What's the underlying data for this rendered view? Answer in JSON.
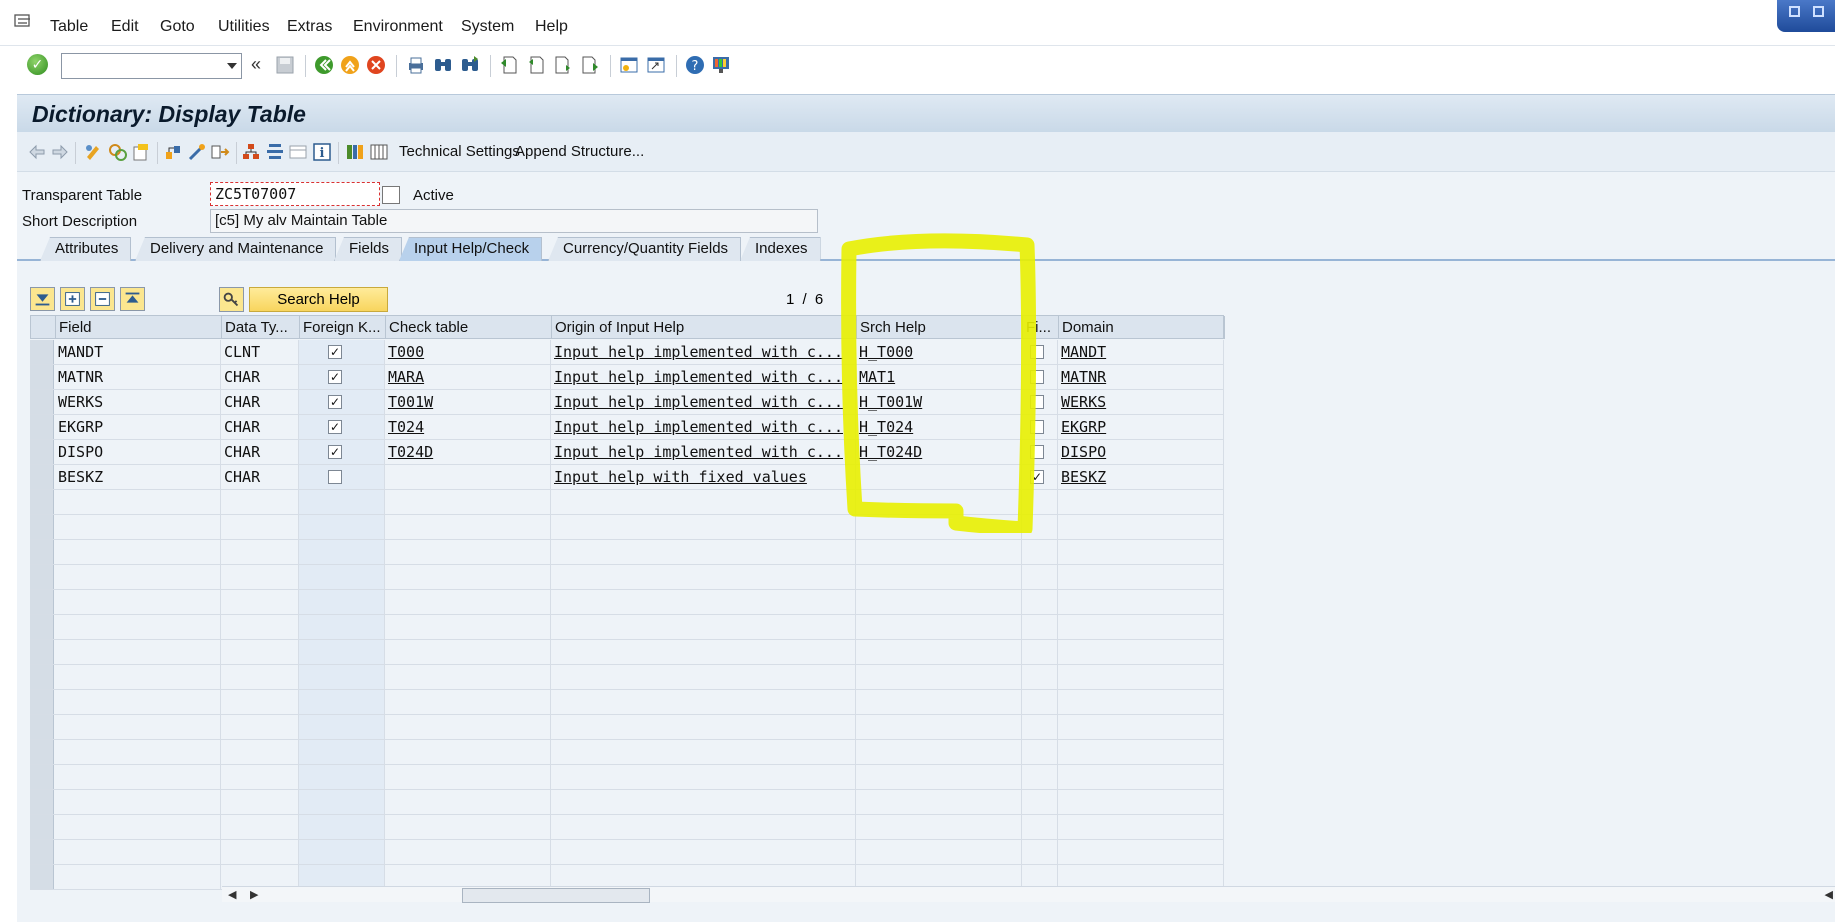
{
  "menu": {
    "items": [
      {
        "label": "Table"
      },
      {
        "label": "Edit"
      },
      {
        "label": "Goto"
      },
      {
        "label": "Utilities"
      },
      {
        "label": "Extras"
      },
      {
        "label": "Environment"
      },
      {
        "label": "System"
      },
      {
        "label": "Help"
      }
    ]
  },
  "systoolbar": {
    "command_value": "",
    "icons": [
      "enter-icon",
      "save-icon",
      "back-icon",
      "exit-icon",
      "cancel-icon",
      "print-icon",
      "find-icon",
      "find-next-icon",
      "first-page-icon",
      "previous-page-icon",
      "next-page-icon",
      "last-page-icon",
      "create-session-icon",
      "shortcut-icon",
      "help-icon",
      "customize-layout-icon"
    ]
  },
  "title": "Dictionary: Display Table",
  "apptoolbar": {
    "technical_settings": "Technical Settings",
    "append_structure": "Append Structure..."
  },
  "header": {
    "table_type_label": "Transparent Table",
    "table_name": "ZC5T07007",
    "status": "Active",
    "short_desc_label": "Short Description",
    "short_desc": "[c5] My alv Maintain Table"
  },
  "tabs": [
    {
      "label": "Attributes",
      "active": false
    },
    {
      "label": "Delivery and Maintenance",
      "active": false
    },
    {
      "label": "Fields",
      "active": false
    },
    {
      "label": "Input Help/Check",
      "active": true
    },
    {
      "label": "Currency/Quantity Fields",
      "active": false
    },
    {
      "label": "Indexes",
      "active": false
    }
  ],
  "table_toolbar": {
    "search_help_label": "Search Help",
    "pager": "1 / 6"
  },
  "grid": {
    "columns": [
      {
        "label": "Field"
      },
      {
        "label": "Data Ty..."
      },
      {
        "label": "Foreign K..."
      },
      {
        "label": "Check table"
      },
      {
        "label": "Origin of Input Help"
      },
      {
        "label": "Srch Help"
      },
      {
        "label": "Fi..."
      },
      {
        "label": "Domain"
      }
    ],
    "rows": [
      {
        "field": "MANDT",
        "type": "CLNT",
        "fk": true,
        "check": "T000",
        "origin": "Input help implemented with c...",
        "srch": "H_T000",
        "fi": false,
        "domain": "MANDT"
      },
      {
        "field": "MATNR",
        "type": "CHAR",
        "fk": true,
        "check": "MARA",
        "origin": "Input help implemented with c...",
        "srch": "MAT1",
        "fi": false,
        "domain": "MATNR"
      },
      {
        "field": "WERKS",
        "type": "CHAR",
        "fk": true,
        "check": "T001W",
        "origin": "Input help implemented with c...",
        "srch": "H_T001W",
        "fi": false,
        "domain": "WERKS"
      },
      {
        "field": "EKGRP",
        "type": "CHAR",
        "fk": true,
        "check": "T024",
        "origin": "Input help implemented with c...",
        "srch": "H_T024",
        "fi": false,
        "domain": "EKGRP"
      },
      {
        "field": "DISPO",
        "type": "CHAR",
        "fk": true,
        "check": "T024D",
        "origin": "Input help implemented with c...",
        "srch": "H_T024D",
        "fi": false,
        "domain": "DISPO"
      },
      {
        "field": "BESKZ",
        "type": "CHAR",
        "fk": false,
        "check": "",
        "origin": "Input help with fixed values",
        "srch": "",
        "fi": true,
        "domain": "BESKZ"
      }
    ],
    "empty_rows": 16
  },
  "colors": {
    "accent_yellow": "#e8f000",
    "header_bg": "#dbe4ee",
    "title_bg": "#c9d9e8"
  }
}
